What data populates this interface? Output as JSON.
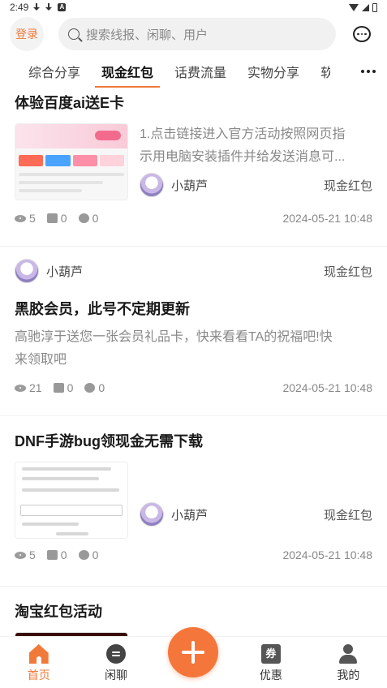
{
  "status_bar": {
    "time": "2:49"
  },
  "header": {
    "login_label": "登录",
    "search_placeholder": "搜索线报、闲聊、用户"
  },
  "tabs": [
    {
      "label": "综合分享"
    },
    {
      "label": "现金红包"
    },
    {
      "label": "话费流量"
    },
    {
      "label": "实物分享"
    },
    {
      "label": "软"
    }
  ],
  "posts": [
    {
      "title": "体验百度ai送E卡",
      "excerpt_line1": "1.点击链接进入官方活动按照网页指",
      "excerpt_line2": "示用电脑安装插件并给发送消息可...",
      "author": "小葫芦",
      "category": "现金红包",
      "views": "5",
      "likes": "0",
      "comments": "0",
      "date": "2024-05-21 10:48"
    },
    {
      "author": "小葫芦",
      "category": "现金红包",
      "title": "黑胶会员，此号不定期更新",
      "excerpt_line1": "高驰淳于送您一张会员礼品卡，快来看看TA的祝福吧!快",
      "excerpt_line2": "来领取吧",
      "views": "21",
      "likes": "0",
      "comments": "0",
      "date": "2024-05-21 10:48"
    },
    {
      "title": "DNF手游bug领现金无需下载",
      "author": "小葫芦",
      "category": "现金红包",
      "views": "5",
      "likes": "0",
      "comments": "0",
      "date": "2024-05-21 10:48"
    },
    {
      "title": "淘宝红包活动"
    }
  ],
  "bottom_nav": {
    "home": "首页",
    "chat": "闲聊",
    "deals": "优惠",
    "deals_icon_char": "券",
    "mine": "我的"
  },
  "colors": {
    "accent": "#f07a3a"
  }
}
